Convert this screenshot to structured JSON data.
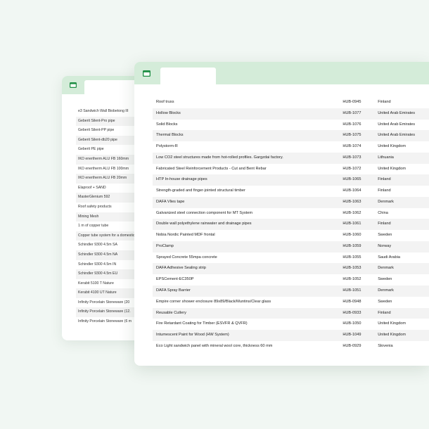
{
  "colors": {
    "background": "#f1f7f3",
    "window_bar": "#d4ecd9",
    "window_icon": "#1f8f45",
    "row_shade": "#f3f3f3"
  },
  "icons": {
    "window": "window-icon"
  },
  "back_window": {
    "items": [
      "e3 Sandwich Wall Biobetong III",
      "Geberit Silent-Pro pipe",
      "Geberit Silent-PP pipe",
      "Geberit Silent-db20 pipe",
      "Geberit PE pipe",
      "IKO enertherm ALU FB 160mm",
      "IKO enertherm ALU FB 100mm",
      "IKO enertherm ALU FB 20mm",
      "Elaproof + SAND",
      "MasterGlenium 592",
      "Roof safety products",
      "Mining Mesh",
      "1 m of copper tube",
      "Copper tube system for a domestic",
      "Schindler 9300 4.5m SA",
      "Schindler 9300 4.5m NA",
      "Schindler 9300 4.5m IN",
      "Schindler 9300 4.5m EU",
      "Kerabit 5100 T Nature",
      "Kerabit 4100 UT Nature",
      "Infinity Porcelain Stoneware (20",
      "Infinity Porcelain Stoneware (12.",
      "Infinity Porcelain Stoneware (6 m"
    ]
  },
  "front_window": {
    "rows": [
      {
        "name": "Roof truss",
        "code": "HUB-0945",
        "country": "Finland"
      },
      {
        "name": "Hollow Blocks",
        "code": "HUB-1077",
        "country": "United Arab Emirates"
      },
      {
        "name": "Solid Blocks",
        "code": "HUB-1076",
        "country": "United Arab Emirates"
      },
      {
        "name": "Thermal Blocks",
        "code": "HUB-1075",
        "country": "United Arab Emirates"
      },
      {
        "name": "Polystorm-R",
        "code": "HUB-1074",
        "country": "United Kingdom"
      },
      {
        "name": "Low CO2 steel structures made from hot-rolled profiles. Gargzdai factory.",
        "code": "HUB-1073",
        "country": "Lithuania"
      },
      {
        "name": "Fabricated Steel Reinforcement Products - Cut and Bent Rebar",
        "code": "HUB-1072",
        "country": "United Kingdom"
      },
      {
        "name": "HTP In-house drainage pipes",
        "code": "HUB-1065",
        "country": "Finland"
      },
      {
        "name": "Strength-graded and finger-jointed structural timber",
        "code": "HUB-1064",
        "country": "Finland"
      },
      {
        "name": "DAFA Vlies tape",
        "code": "HUB-1063",
        "country": "Denmark"
      },
      {
        "name": "Galvanized steel connection component for MT System",
        "code": "HUB-1062",
        "country": "China"
      },
      {
        "name": "Double wall polyethylene rainwater and drainage pipes",
        "code": "HUB-1061",
        "country": "Finland"
      },
      {
        "name": "Nobia Nordic Painted MDF frontal",
        "code": "HUB-1060",
        "country": "Sweden"
      },
      {
        "name": "ProClamp",
        "code": "HUB-1059",
        "country": "Norway"
      },
      {
        "name": "Sprayed Concrete 55mpa concrete",
        "code": "HUB-1055",
        "country": "Saudi Arabia"
      },
      {
        "name": "DAFA Adhesive Sealing strip",
        "code": "HUB-1053",
        "country": "Denmark"
      },
      {
        "name": "EPSCement-EC350P",
        "code": "HUB-1052",
        "country": "Sweden"
      },
      {
        "name": "DAFA Spray Barrier",
        "code": "HUB-1051",
        "country": "Denmark"
      },
      {
        "name": "Empire corner shower enclosure 89x89/Black/Muntins/Clear glass",
        "code": "HUB-0948",
        "country": "Sweden"
      },
      {
        "name": "Reusable Cutlery",
        "code": "HUB-0933",
        "country": "Finland"
      },
      {
        "name": "Fire Retardant Coating for Timber (ESVFR & QVFR)",
        "code": "HUB-1050",
        "country": "United Kingdom"
      },
      {
        "name": "Intumescent Paint for Wood (HW System)",
        "code": "HUB-1049",
        "country": "United Kingdom"
      },
      {
        "name": "Eco Light sandwich panel with mineral wool core, thickness 60 mm",
        "code": "HUB-0929",
        "country": "Slovenia"
      }
    ]
  }
}
